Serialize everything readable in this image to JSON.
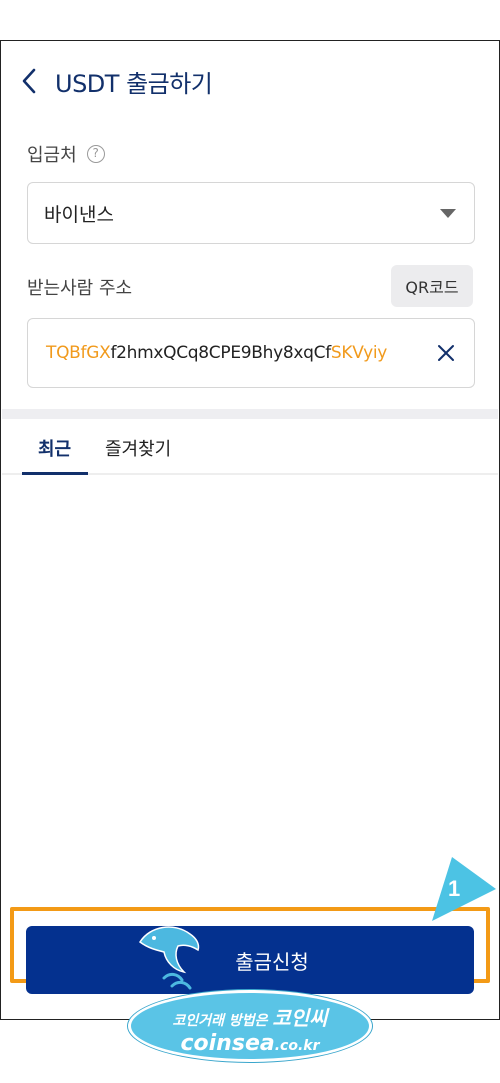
{
  "header": {
    "title": "USDT 출금하기"
  },
  "destination": {
    "label": "입금처",
    "help_glyph": "?",
    "selected": "바이낸스"
  },
  "address": {
    "label": "받는사람 주소",
    "qr_button": "QR코드",
    "value_prefix": "TQBfGX",
    "value_middle": "f2hmxQCq8CPE9Bhy8xqCf",
    "value_suffix": "SKVyiy"
  },
  "tabs": [
    {
      "label": "최근",
      "active": true
    },
    {
      "label": "즐겨찾기",
      "active": false
    }
  ],
  "submit": {
    "label": "출금신청"
  },
  "annotation": {
    "step_number": "1",
    "highlight_color": "#f39a16",
    "arrow_color": "#4cc3e4"
  },
  "watermark": {
    "line1_small": "코인거래 방법은",
    "line1_big": "코인씨",
    "line2_domain": "coinsea",
    "line2_tld": ".co.kr"
  },
  "colors": {
    "primary": "#04318f",
    "title": "#12306b",
    "address_highlight": "#f19a1c"
  }
}
